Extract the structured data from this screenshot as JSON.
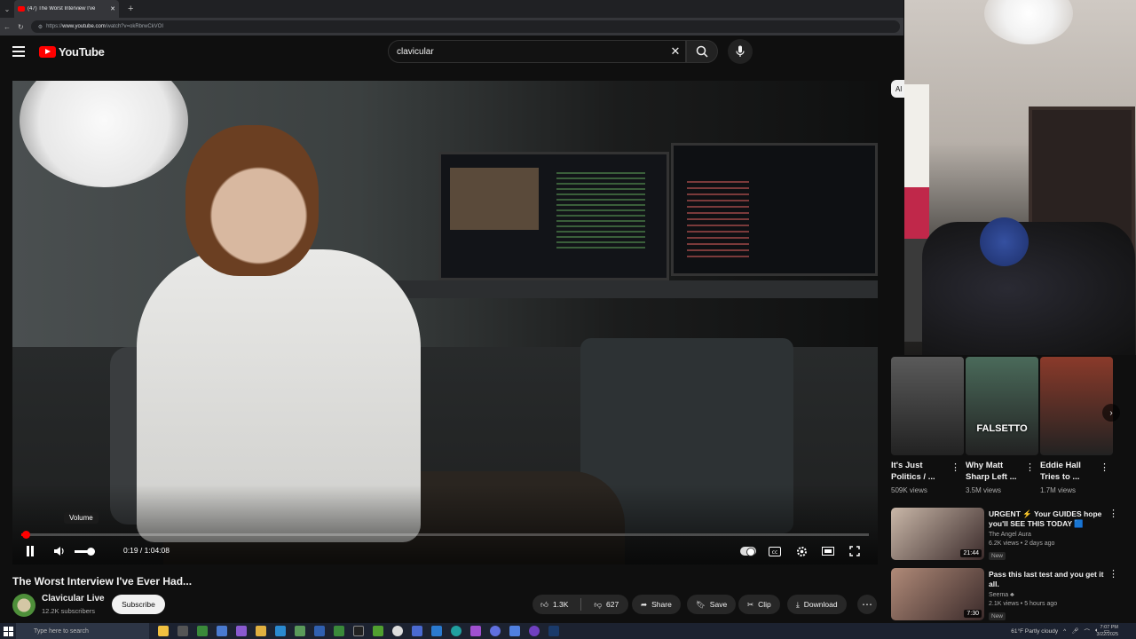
{
  "browser": {
    "tab_title": "(47) The Worst Interview I've",
    "url_prefix": "https://",
    "url_domain": "www.youtube.com",
    "url_path": "/watch?v=okRbrwCkVOI"
  },
  "header": {
    "logo_text": "YouTube",
    "search_query": "clavicular"
  },
  "player": {
    "tooltip": "Volume",
    "time": "0:19 / 1:04:08",
    "progress_fraction": 0.005,
    "volume_fraction": 0.6,
    "autoplay_on": true
  },
  "video": {
    "title": "The Worst Interview I've Ever Had...",
    "channel": "Clavicular Live",
    "subscribers": "12.2K subscribers",
    "subscribe_label": "Subscribe",
    "likes": "1.3K",
    "dislikes": "627",
    "share_label": "Share",
    "save_label": "Save",
    "clip_label": "Clip",
    "download_label": "Download"
  },
  "sidebar": {
    "chip_label": "Al",
    "shorts": [
      {
        "title": "It's Just Politics / ...",
        "views": "509K views",
        "overlay": "",
        "bg": "#5a5a5a"
      },
      {
        "title": "Why Matt Sharp Left ...",
        "views": "3.5M views",
        "overlay": "FALSETTO",
        "bg": "#4a6a5a"
      },
      {
        "title": "Eddie Hall Tries to ...",
        "views": "1.7M views",
        "overlay": "",
        "bg": "#8a3a2a"
      }
    ],
    "recommendations": [
      {
        "title": "URGENT ⚡ Your GUIDES hope you'll SEE THIS TODAY 🟦",
        "channel": "The Angel Aura",
        "stats": "6.2K views • 2 days ago",
        "badge": "New",
        "duration": "21:44",
        "bg": "#c9b7a8"
      },
      {
        "title": "Pass this last test and you get it all.",
        "channel": "Seema ♣",
        "stats": "2.1K views • 5 hours ago",
        "badge": "New",
        "duration": "7:30",
        "bg": "#b08a78"
      }
    ]
  },
  "taskbar": {
    "search_placeholder": "Type here to search",
    "weather": "61°F  Partly cloudy",
    "time": "7:07 PM",
    "date": "3/22/2025"
  }
}
